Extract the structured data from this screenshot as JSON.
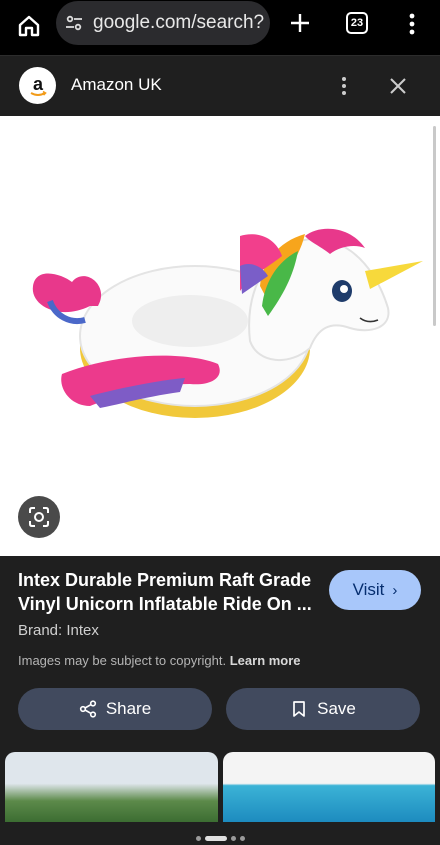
{
  "browser": {
    "url": "google.com/search?",
    "tab_count": "23",
    "icons": [
      "home-icon",
      "tune-icon",
      "plus-icon",
      "tabs-icon",
      "more-vert-icon"
    ]
  },
  "source": {
    "logo_letter": "a",
    "name": "Amazon UK",
    "icons": [
      "more-vert-icon",
      "close-icon"
    ]
  },
  "product": {
    "title_line1": "Intex Durable Premium Raft Grade",
    "title_line2": "Vinyl Unicorn Inflatable Ride On ...",
    "visit_label": "Visit",
    "brand": "Brand: Intex",
    "copyright_text": "Images may be subject to copyright.",
    "learn_more": "Learn more",
    "share_label": "Share",
    "save_label": "Save"
  },
  "colors": {
    "accent": "#a8c7fa",
    "panel": "#1f1f1f",
    "button": "#414a5e"
  },
  "pager": {
    "active_index": 1,
    "count": 4
  }
}
